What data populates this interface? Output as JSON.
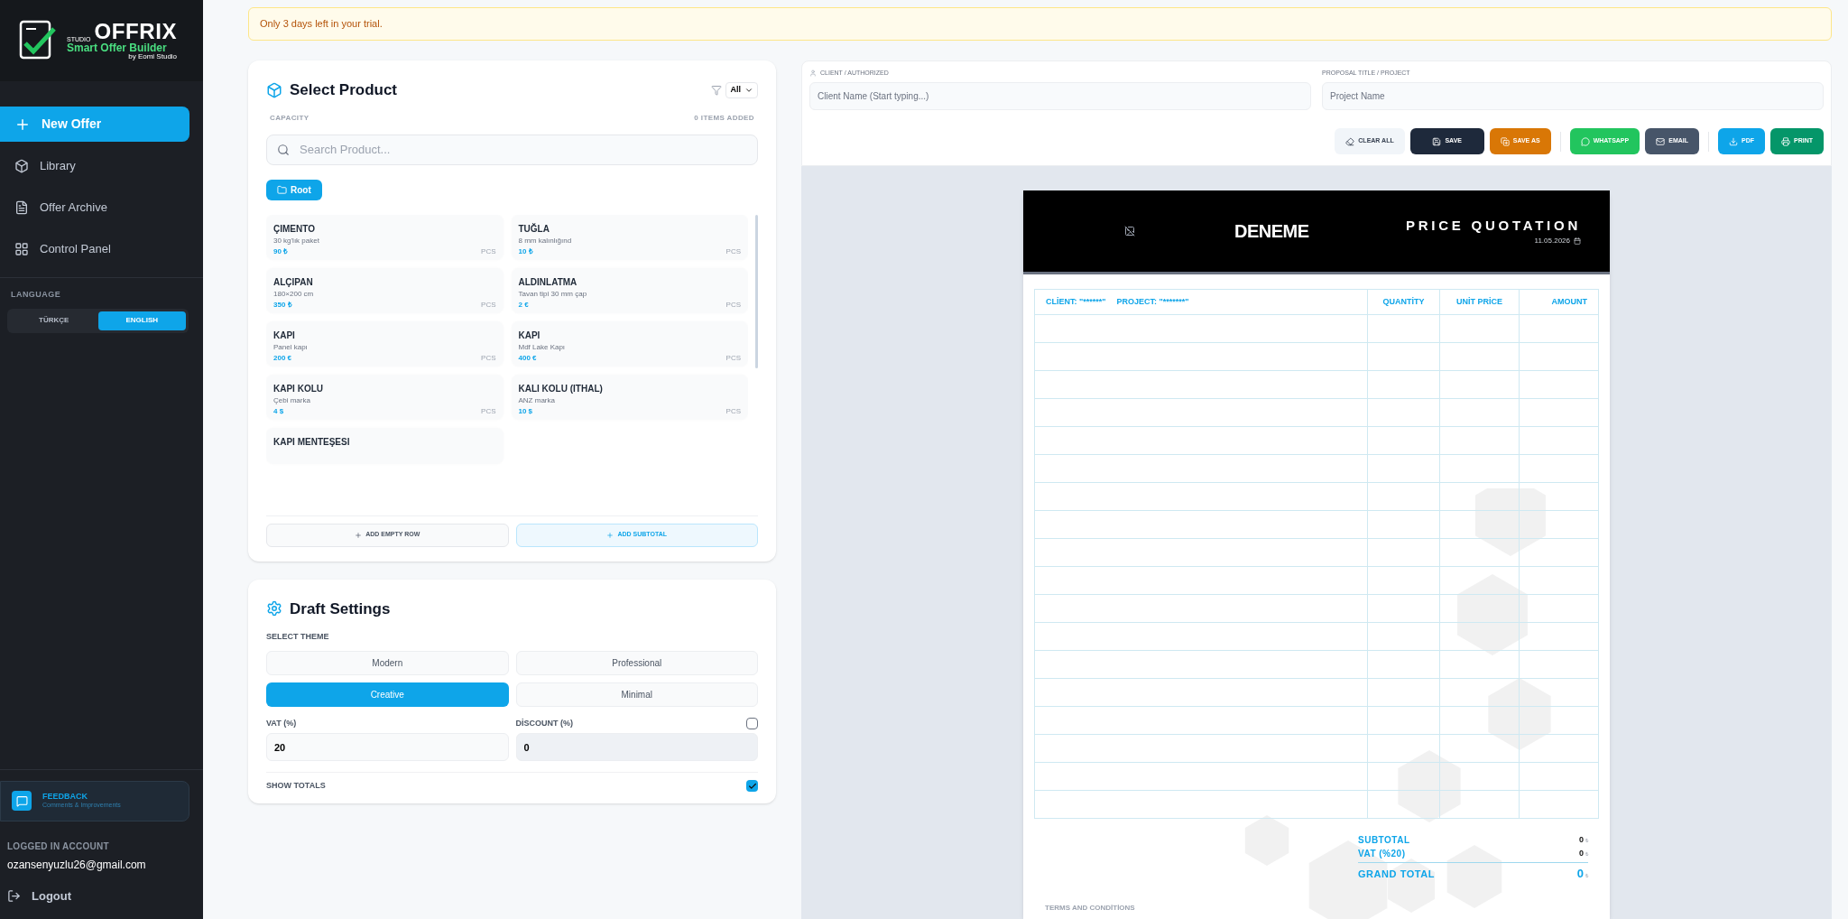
{
  "sidebar": {
    "logo": {
      "studio": "STUDIO",
      "name": "OFFRIX",
      "tagline": "Smart Offer Builder",
      "by": "by Eomi Studio"
    },
    "new_offer": "New Offer",
    "nav": [
      {
        "label": "Library"
      },
      {
        "label": "Offer Archive"
      },
      {
        "label": "Control Panel"
      }
    ],
    "language_label": "LANGUAGE",
    "languages": [
      {
        "label": "TÜRKÇE",
        "selected": false
      },
      {
        "label": "ENGLISH",
        "selected": true
      }
    ],
    "feedback": {
      "title": "FEEDBACK",
      "subtitle": "Comments & Improvements"
    },
    "account_label": "LOGGED IN ACCOUNT",
    "email": "ozansenyuzlu26@gmail.com",
    "logout": "Logout"
  },
  "trial_banner": "Only 3 days left in your trial.",
  "select_product": {
    "title": "Select Product",
    "filter": "All",
    "capacity": "CAPACITY",
    "items_added": "0 ITEMS ADDED",
    "search_placeholder": "Search Product...",
    "folder": "Root",
    "products": [
      {
        "name": "ÇIMENTO",
        "desc": "30 kg'lık paket",
        "price": "90 ₺",
        "unit": "PCS"
      },
      {
        "name": "TUĞLA",
        "desc": "8 mm kalınlığınd",
        "price": "10 ₺",
        "unit": "PCS"
      },
      {
        "name": "ALÇIPAN",
        "desc": "180×200 cm",
        "price": "350 ₺",
        "unit": "PCS"
      },
      {
        "name": "ALDINLATMA",
        "desc": "Tavan tipi 30 mm çap",
        "price": "2 €",
        "unit": "PCS"
      },
      {
        "name": "KAPI",
        "desc": "Panel kapı",
        "price": "200 €",
        "unit": "PCS"
      },
      {
        "name": "KAPI",
        "desc": "Mdf Lake Kapı",
        "price": "400 €",
        "unit": "PCS"
      },
      {
        "name": "KAPI KOLU",
        "desc": "Çebi marka",
        "price": "4 $",
        "unit": "PCS"
      },
      {
        "name": "KALI KOLU (ITHAL)",
        "desc": "ANZ marka",
        "price": "10 $",
        "unit": "PCS"
      },
      {
        "name": "KAPI MENTEŞESI"
      }
    ],
    "add_empty_row": "ADD EMPTY ROW",
    "add_subtotal": "ADD SUBTOTAL"
  },
  "draft_settings": {
    "title": "Draft Settings",
    "theme_label": "SELECT THEME",
    "themes": [
      {
        "label": "Modern",
        "selected": false
      },
      {
        "label": "Professional",
        "selected": false
      },
      {
        "label": "Creative",
        "selected": true
      },
      {
        "label": "Minimal",
        "selected": false
      }
    ],
    "vat_label": "VAT (%)",
    "vat_value": "20",
    "discount_label": "DİSCOUNT (%)",
    "discount_checked": false,
    "discount_value": "0",
    "show_totals_label": "SHOW TOTALS",
    "show_totals_checked": true
  },
  "header_form": {
    "client_label": "CLIENT / AUTHORIZED",
    "client_placeholder": "Client Name (Start typing...)",
    "project_label": "PROPOSAL TITLE / PROJECT",
    "project_placeholder": "Project Name"
  },
  "toolbar": [
    {
      "label": "CLEAR ALL",
      "kind": "clear"
    },
    {
      "label": "SAVE",
      "kind": "save"
    },
    {
      "label": "SAVE AS",
      "kind": "saveas"
    },
    {
      "label": "WHATSAPP",
      "kind": "whatsapp"
    },
    {
      "label": "EMAIL",
      "kind": "email"
    },
    {
      "label": "PDF",
      "kind": "pdf"
    },
    {
      "label": "PRINT",
      "kind": "print"
    }
  ],
  "document": {
    "company": "DENEME",
    "title": "PRICE QUOTATION",
    "date": "11.05.2026",
    "client": "CLİENT: \"******\"",
    "project": "PROJECT: \"*******\"",
    "columns": [
      "QUANTİTY",
      "UNİT PRİCE",
      "AMOUNT"
    ],
    "totals": [
      {
        "label": "SUBTOTAL",
        "value": "0",
        "currency": "₺",
        "kind": "normal"
      },
      {
        "label": "VAT (%20)",
        "value": "0",
        "currency": "₺",
        "kind": "normal"
      },
      {
        "label": "GRAND TOTAL",
        "value": "0",
        "currency": "₺",
        "kind": "grand"
      }
    ],
    "terms": "TERMS AND CONDİTİONS"
  }
}
